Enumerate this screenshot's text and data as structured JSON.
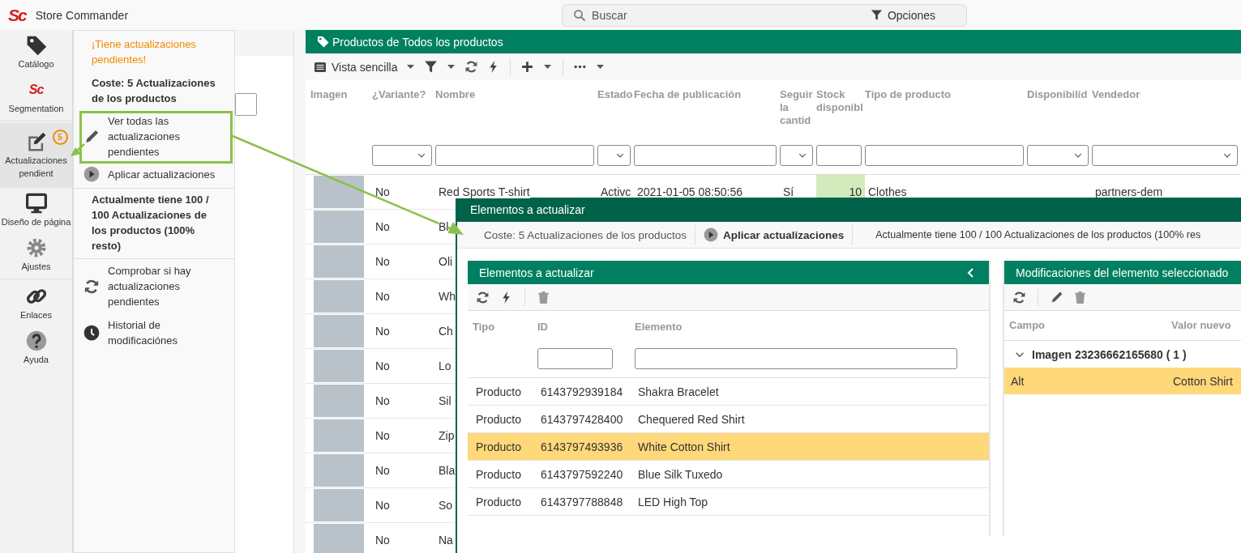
{
  "app": {
    "logo": "Sc",
    "title": "Store Commander"
  },
  "search": {
    "placeholder": "Buscar",
    "options_label": "Opciones"
  },
  "sidebar": {
    "items": [
      {
        "label": "Catálogo",
        "selected": false
      },
      {
        "label": "Segmentation",
        "icon_text": "Sc",
        "selected": false
      },
      {
        "label": "Actualizaciones pendient",
        "badge": "5",
        "selected": true
      },
      {
        "label": "Diseño de página",
        "selected": false
      },
      {
        "label": "Ajustes",
        "selected": false
      },
      {
        "label": "Enlaces",
        "selected": false
      },
      {
        "label": "Ayuda",
        "selected": false
      }
    ]
  },
  "updates_menu": {
    "items": [
      {
        "kind": "notice",
        "text": "¡Tiene actualizaciones pendientes!"
      },
      {
        "kind": "info",
        "text": "Coste: 5 Actualizaciones de los productos"
      },
      {
        "kind": "action",
        "text": "Ver todas las actualizaciones pendientes",
        "highlighted": true
      },
      {
        "kind": "action",
        "text": "Aplicar actualizaciones",
        "highlighted": false
      },
      {
        "kind": "info",
        "text": "Actualmente tiene 100 / 100 Actualizaciones de los productos (100% resto)"
      },
      {
        "kind": "action",
        "text": "Comprobar si hay actualizaciones pendientes",
        "highlighted": false
      },
      {
        "kind": "action",
        "text": "Historial de modificaciónes",
        "highlighted": false
      }
    ]
  },
  "products": {
    "title": "Productos de Todos los productos",
    "toolbar": {
      "view": "Vista sencilla"
    },
    "columns": [
      {
        "label": "Imagen",
        "kind": "plain"
      },
      {
        "label": "¿Variante?",
        "kind": "select"
      },
      {
        "label": "Nombre",
        "kind": "input"
      },
      {
        "label": "Estado",
        "kind": "select"
      },
      {
        "label": "Fecha de publicación",
        "kind": "input"
      },
      {
        "label": "Seguir la cantid",
        "kind": "select"
      },
      {
        "label": "Stock disponibl",
        "kind": "input"
      },
      {
        "label": "Tipo de producto",
        "kind": "input"
      },
      {
        "label": "Disponibilid",
        "kind": "select"
      },
      {
        "label": "Vendedor",
        "kind": "select"
      }
    ],
    "rows": [
      {
        "variant": "No",
        "name": "Red Sports T-shirt",
        "status": "Activc",
        "published": "2021-01-05 08:50:56",
        "track": "Sí",
        "stock": "10",
        "stock_highlighted": true,
        "type": "Clothes",
        "vendor": "partners-dem"
      },
      {
        "variant": "No",
        "name": "Bl"
      },
      {
        "variant": "No",
        "name": "Oli"
      },
      {
        "variant": "No",
        "name": "Wh"
      },
      {
        "variant": "No",
        "name": "Ch"
      },
      {
        "variant": "No",
        "name": "Lo"
      },
      {
        "variant": "No",
        "name": "Sil"
      },
      {
        "variant": "No",
        "name": "Zip"
      },
      {
        "variant": "No",
        "name": "Bla"
      },
      {
        "variant": "No",
        "name": "So"
      },
      {
        "variant": "No",
        "name": "Na"
      }
    ]
  },
  "update_window": {
    "title": "Elementos a actualizar",
    "info": {
      "cost": "Coste: 5 Actualizaciones de los productos",
      "apply": "Aplicar actualizaciones",
      "quota": "Actualmente tiene 100 / 100 Actualizaciones de los productos (100% res"
    },
    "items_panel": {
      "title": "Elementos a actualizar",
      "columns": [
        "Tipo",
        "ID",
        "Elemento"
      ],
      "rows": [
        {
          "type": "Producto",
          "id": "6143792939184",
          "element": "Shakra Bracelet",
          "selected": false
        },
        {
          "type": "Producto",
          "id": "6143797428400",
          "element": "Chequered Red Shirt",
          "selected": false
        },
        {
          "type": "Producto",
          "id": "6143797493936",
          "element": "White Cotton Shirt",
          "selected": true
        },
        {
          "type": "Producto",
          "id": "6143797592240",
          "element": "Blue Silk Tuxedo",
          "selected": false
        },
        {
          "type": "Producto",
          "id": "6143797788848",
          "element": "LED High Top",
          "selected": false
        }
      ]
    },
    "changes_panel": {
      "title": "Modificaciones del elemento seleccionado",
      "columns": [
        "Campo",
        "Valor nuevo"
      ],
      "groups": [
        {
          "label": "Imagen 23236662165680 ( 1 )",
          "expanded": true,
          "rows": [
            {
              "field": "Alt",
              "value": "Cotton Shirt",
              "selected": true
            }
          ]
        }
      ]
    }
  }
}
